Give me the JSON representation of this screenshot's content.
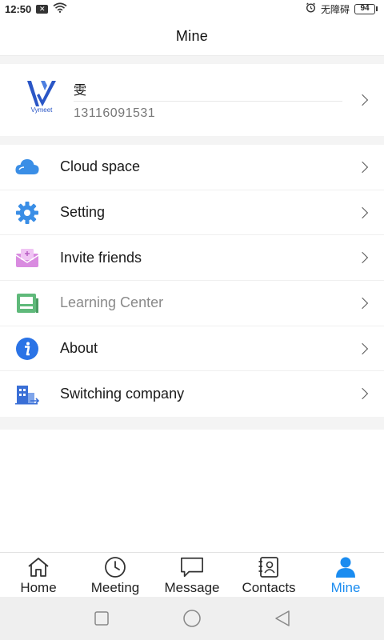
{
  "status_bar": {
    "time": "12:50",
    "notification": "✕",
    "network_text": "无障碍",
    "battery": "94"
  },
  "header": {
    "title": "Mine"
  },
  "profile": {
    "logo_text": "Vymeet",
    "name": "雯",
    "phone": "13116091531"
  },
  "menu": {
    "items": [
      {
        "label": "Cloud space",
        "icon": "cloud-icon"
      },
      {
        "label": "Setting",
        "icon": "gear-icon"
      },
      {
        "label": "Invite friends",
        "icon": "invite-mail-icon"
      },
      {
        "label": "Learning Center",
        "icon": "learning-center-icon"
      },
      {
        "label": "About",
        "icon": "info-icon"
      },
      {
        "label": "Switching company",
        "icon": "company-switch-icon"
      }
    ]
  },
  "tabs": [
    {
      "label": "Home",
      "icon": "home-icon",
      "active": false
    },
    {
      "label": "Meeting",
      "icon": "clock-icon",
      "active": false
    },
    {
      "label": "Message",
      "icon": "chat-bubble-icon",
      "active": false
    },
    {
      "label": "Contacts",
      "icon": "contacts-book-icon",
      "active": false
    },
    {
      "label": "Mine",
      "icon": "person-icon",
      "active": true
    }
  ],
  "colors": {
    "accent": "#1a8cf0",
    "cloud": "#3a8ee6",
    "gear": "#3a8ee6",
    "invite": "#d98be0",
    "learning": "#5fb97a",
    "info": "#2a73e6",
    "company": "#3a6fd6"
  }
}
